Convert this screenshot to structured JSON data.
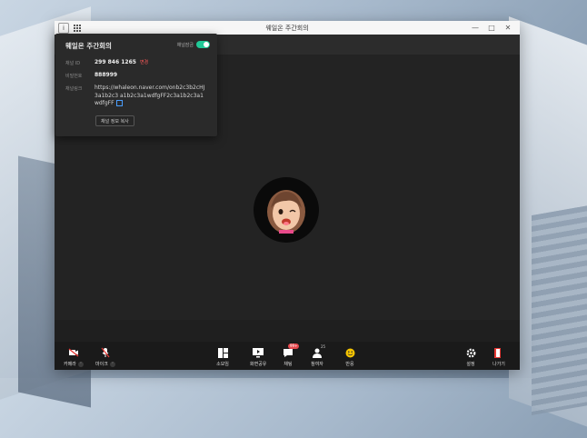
{
  "window": {
    "title": "웨일온 주간회의"
  },
  "info_panel": {
    "title": "웨일온 주간회의",
    "lock_label": "채널잠금",
    "rows": [
      {
        "key": "채널 ID",
        "value": "299 846 1265",
        "action": "변경"
      },
      {
        "key": "비밀번호",
        "value": "888999"
      },
      {
        "key": "채널링크",
        "value": "https://whaleon.naver.com/onb2c3b2cHJ3a1b2c3 a1b2c3a1wdfgFF2c3a1b2c3a1wdfgFF"
      }
    ],
    "copy_button": "채널 정보 복사"
  },
  "controls": {
    "camera": "카메라",
    "mic": "마이크",
    "layout": "소모임",
    "screen_share": "화면공유",
    "chat": "채팅",
    "chat_badge": "99+",
    "participants": "참여자",
    "participants_count": "25",
    "reactions": "반응",
    "settings": "설정",
    "leave": "나가기"
  },
  "colors": {
    "accent": "#20c997",
    "danger": "#e5484d",
    "leave": "#e53935"
  },
  "icons": [
    "info-icon",
    "grid-icon",
    "minimize-icon",
    "maximize-icon",
    "close-icon",
    "camera-off-icon",
    "mic-off-icon",
    "layout-icon",
    "screen-share-icon",
    "chat-icon",
    "participants-icon",
    "reaction-icon",
    "settings-icon",
    "exit-icon",
    "copy-link-icon"
  ]
}
